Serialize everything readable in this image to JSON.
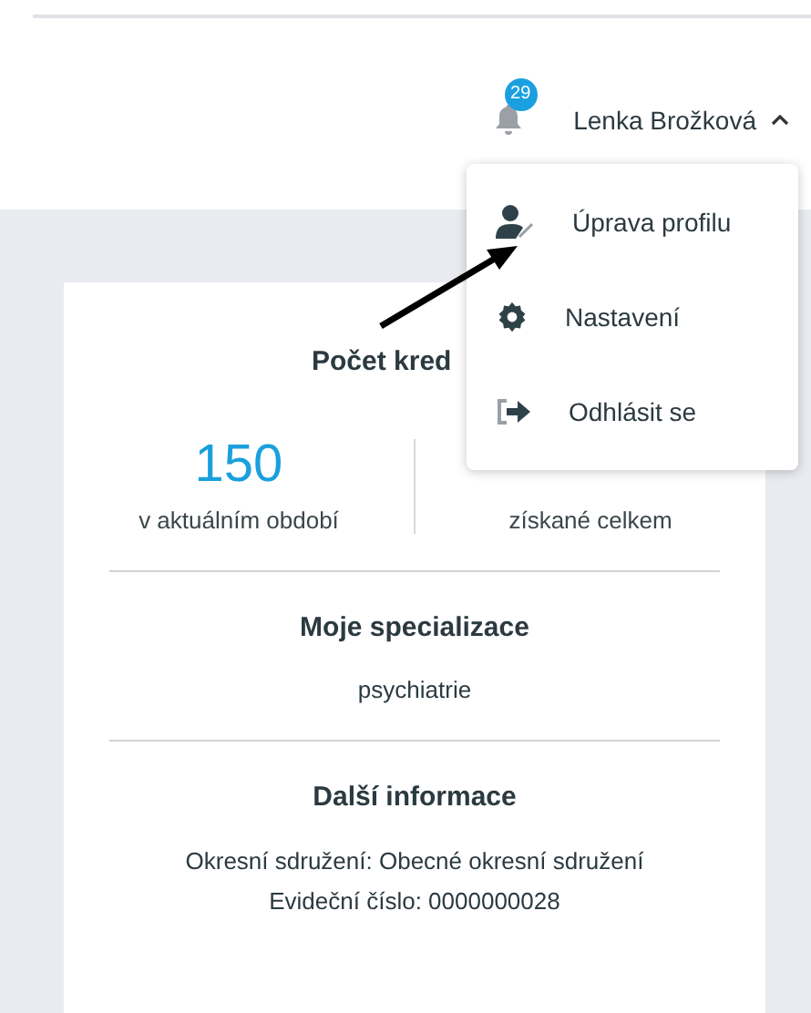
{
  "header": {
    "notifications": {
      "count": "29"
    },
    "user": {
      "name": "Lenka Brožková",
      "expanded": true
    }
  },
  "user_menu": [
    {
      "kind": "profile",
      "label": "Úprava profilu"
    },
    {
      "kind": "settings",
      "label": "Nastavení"
    },
    {
      "kind": "logout",
      "label": "Odhlásit se"
    }
  ],
  "credits": {
    "title": "Počet kred",
    "stats": [
      {
        "value": "150",
        "label": "v aktuálním období"
      },
      {
        "label": "získané celkem"
      }
    ]
  },
  "specialization": {
    "title": "Moje specializace",
    "value": "psychiatrie"
  },
  "info": {
    "title": "Další informace",
    "lines": [
      "Okresní sdružení: Obecné okresní sdružení",
      "Evideční číslo: 0000000028"
    ]
  }
}
